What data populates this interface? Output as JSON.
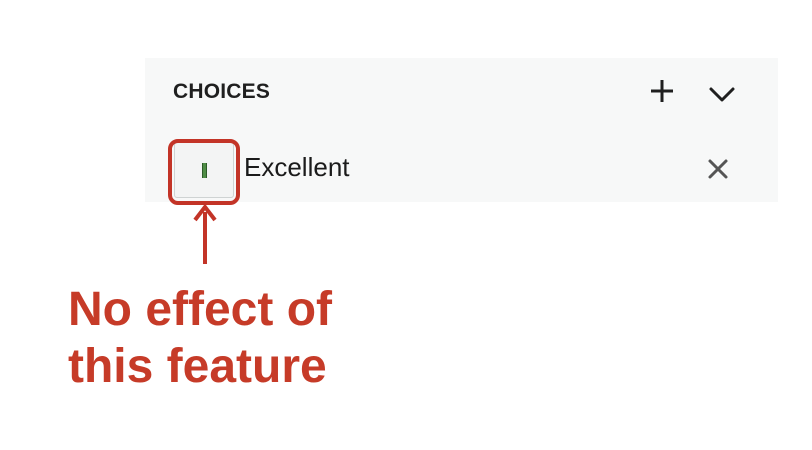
{
  "panel": {
    "title": "CHOICES",
    "add_icon": "plus-icon",
    "collapse_icon": "chevron-down-icon"
  },
  "choices": [
    {
      "label": "Excellent",
      "color": "#4f8d46",
      "remove_icon": "close-icon"
    }
  ],
  "annotation": {
    "line1": "No effect of",
    "line2": "this feature",
    "color": "#c63b28"
  },
  "colors": {
    "panel_bg": "#f7f8f8",
    "annotation_red": "#c33427"
  }
}
